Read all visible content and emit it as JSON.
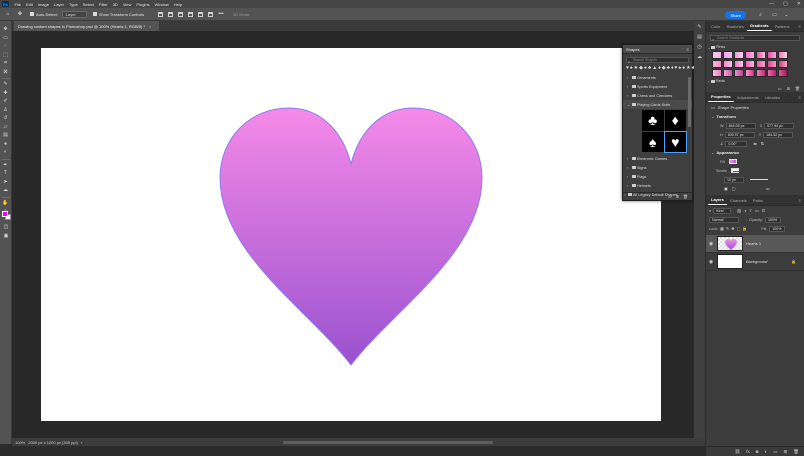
{
  "menubar": {
    "logo": "Ps",
    "items": [
      "File",
      "Edit",
      "Image",
      "Layer",
      "Type",
      "Select",
      "Filter",
      "3D",
      "View",
      "Plugins",
      "Window",
      "Help"
    ],
    "win_controls": [
      "—",
      "▢",
      "✕"
    ]
  },
  "options": {
    "auto_select_label": "Auto-Select:",
    "auto_select_value": "Layer",
    "transform_label": "Show Transform Controls",
    "mode_3d": "3D Mode:",
    "share_label": "Share"
  },
  "document_tab": {
    "title": "Drawing custom shapes in Photoshop.psd @ 100% (Hearts 1, RGB/8) *",
    "close": "×"
  },
  "status": {
    "zoom": "100%",
    "doc_info": "2000 px x 1200 px (300 ppi)",
    "arrow": "›"
  },
  "colors": {
    "foreground": "#f200ff",
    "background": "#ffffff",
    "heart_top": "#f58ae8",
    "heart_bottom": "#9a52cf",
    "heart_outline": "#8a7ff0",
    "accent": "#1473e6"
  },
  "shapes_panel": {
    "title": "Shapes",
    "search_placeholder": "Search Shapes",
    "recent_shapes": [
      "♥",
      "♠",
      "★",
      "◆",
      "●",
      "♣",
      "▲",
      "♦",
      "◆",
      "♣",
      "♦",
      "♥",
      "♠",
      "●",
      "★",
      "♣",
      "▲"
    ],
    "groups": [
      {
        "label": "Ornaments",
        "expanded": false
      },
      {
        "label": "Sports Equipment",
        "expanded": false
      },
      {
        "label": "Chess and Checkers",
        "expanded": false
      },
      {
        "label": "Playing Cards Suits",
        "expanded": true
      }
    ],
    "card_shapes": [
      {
        "glyph": "♣",
        "name": "club"
      },
      {
        "glyph": "♦",
        "name": "diamond"
      },
      {
        "glyph": "♠",
        "name": "spade"
      },
      {
        "glyph": "♥",
        "name": "heart"
      }
    ],
    "more_groups": [
      "Electronic Games",
      "Signs",
      "Flags",
      "Helmets"
    ],
    "legacy_group": "All Legacy Default Shapes"
  },
  "gradients_panel": {
    "tabs": [
      "Color",
      "Swatches",
      "Gradients",
      "Patterns"
    ],
    "active_tab": "Gradients",
    "search_placeholder": "Search Gradients",
    "folders": [
      "Pinks",
      "Reds"
    ],
    "swatches": [
      [
        "#f6c7e9",
        "#f7b8ea"
      ],
      [
        "#f3a4e8",
        "#f2c1f3"
      ],
      [
        "#f59ad8",
        "#ffd1ef"
      ],
      [
        "#f36cc8",
        "#ffb3e5"
      ],
      [
        "#f04fa8",
        "#ffc5e3"
      ],
      [
        "#e94aa9",
        "#f7a8d6"
      ],
      [
        "#ff6fb7",
        "#ffd6eb"
      ],
      [
        "#fbb0d8",
        "#ff8fc8"
      ],
      [
        "#f48bd0",
        "#fcc0ec"
      ],
      [
        "#ef7ac4",
        "#ffc7ea"
      ],
      [
        "#ee5fb7",
        "#ffb8e1"
      ],
      [
        "#eb57a5",
        "#f9a3c9"
      ],
      [
        "#e0448f",
        "#f596c2"
      ],
      [
        "#d9377c",
        "#f4a7c8"
      ],
      [
        "#f9c3e4",
        "#e97cc5"
      ],
      [
        "#f3a8d6",
        "#c755ac"
      ],
      [
        "#e993c9",
        "#b5448f"
      ],
      [
        "#ff9acc",
        "#d82a83"
      ],
      [
        "#f27cb3",
        "#c8287a"
      ],
      [
        "#ea6ba3",
        "#b7206b"
      ],
      [
        "#e25b95",
        "#a0185c"
      ]
    ]
  },
  "properties_panel": {
    "tabs": [
      "Properties",
      "Adjustments",
      "Libraries"
    ],
    "active_tab": "Properties",
    "layer_kind": "Shape Properties",
    "transform_label": "Transform",
    "w_label": "W",
    "w_value": "844.09 px",
    "x_label": "X",
    "x_value": "577.94 px",
    "h_label": "H",
    "h_value": "830.97 px",
    "y_label": "Y",
    "y_value": "184.52 px",
    "angle_value": "0.00°",
    "appearance_label": "Appearance",
    "fill_label": "Fill",
    "stroke_label": "Stroke",
    "stroke_width": "10 px"
  },
  "layers_panel": {
    "tabs": [
      "Layers",
      "Channels",
      "Paths"
    ],
    "active_tab": "Layers",
    "filter_label": "Kind",
    "blend_mode": "Normal",
    "opacity_label": "Opacity:",
    "opacity_value": "100%",
    "lock_label": "Lock:",
    "fill_label": "Fill:",
    "fill_value": "100%",
    "layers": [
      {
        "name": "Hearts 1",
        "selected": true,
        "italic": false
      },
      {
        "name": "Background",
        "selected": false,
        "italic": true
      }
    ],
    "footer_icons": [
      "link-icon",
      "fx-icon",
      "mask-icon",
      "adjust-icon",
      "folder-icon",
      "new-layer-icon",
      "trash-icon"
    ]
  }
}
